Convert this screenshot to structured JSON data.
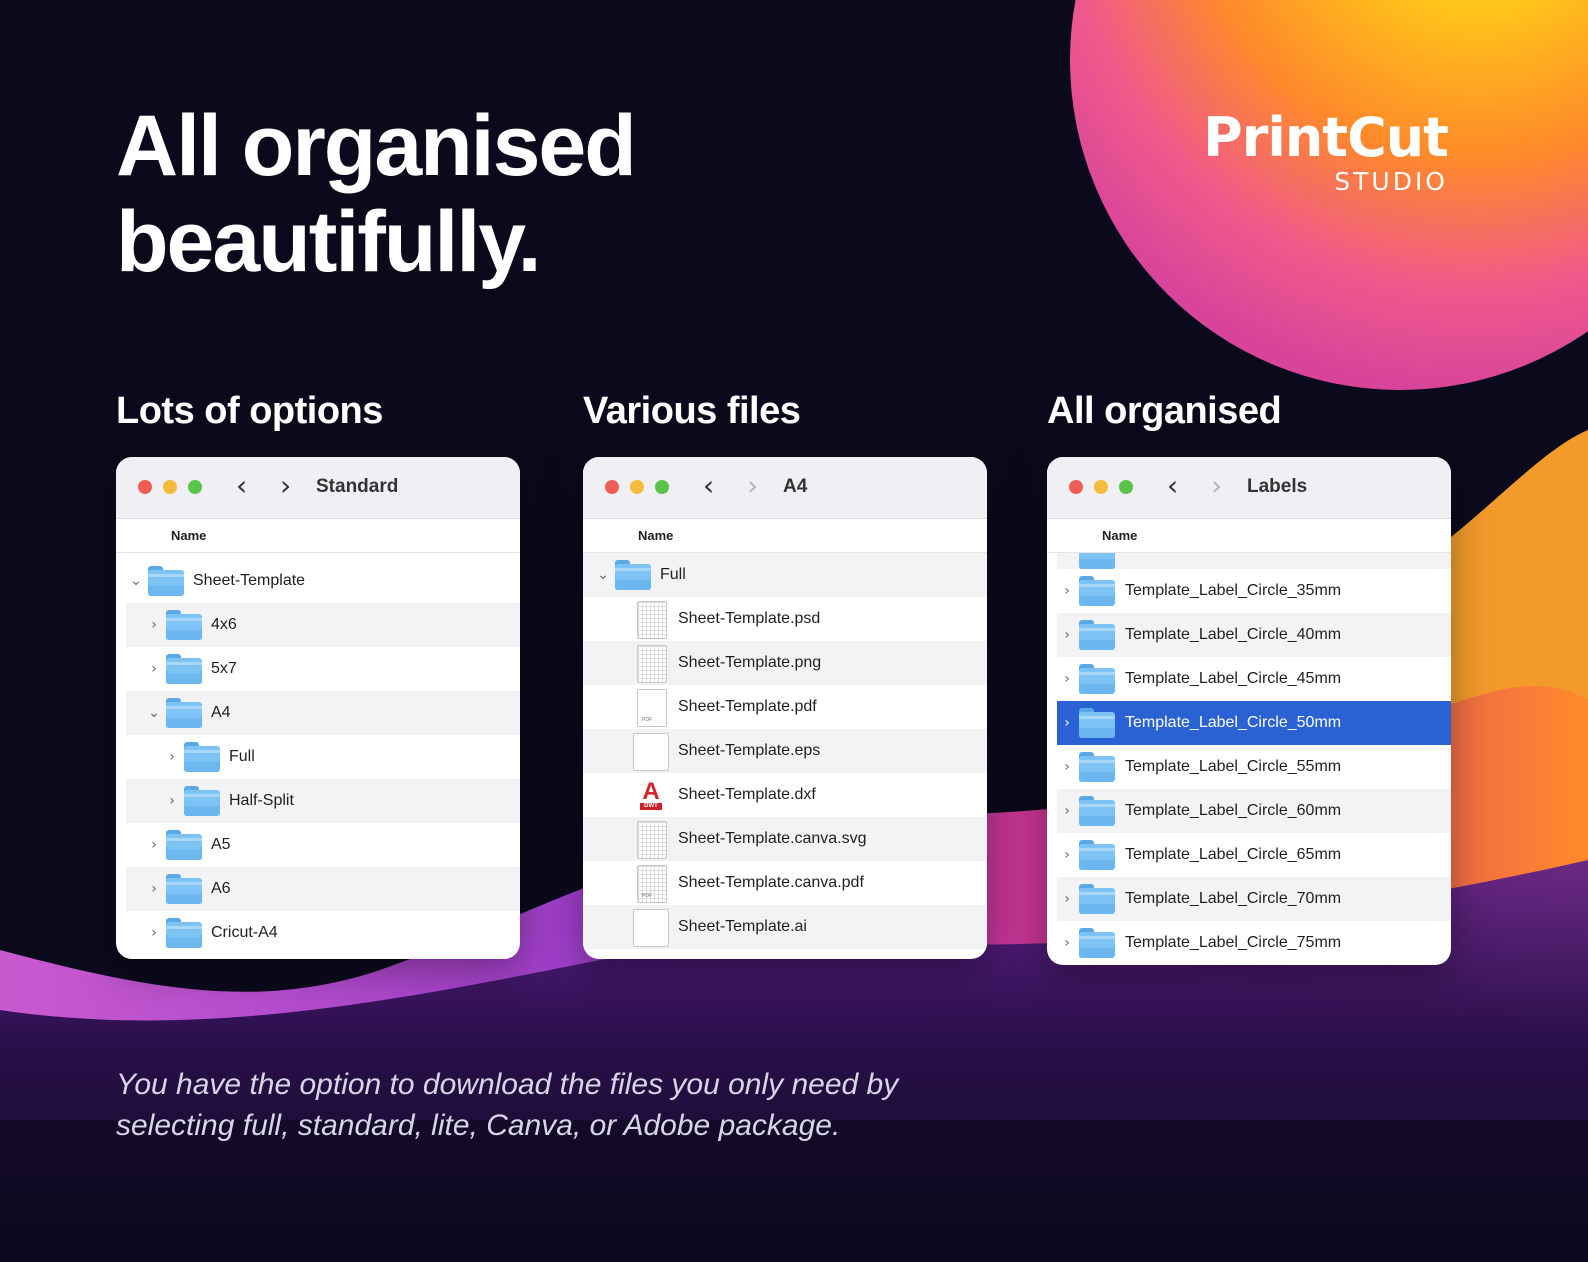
{
  "headline": {
    "line1": "All organised",
    "line2": "beautifully."
  },
  "brand": {
    "name": "PrintCut",
    "sub": "STUDIO"
  },
  "sections": {
    "left_title": "Lots of options",
    "middle_title": "Various files",
    "right_title": "All organised"
  },
  "windows": {
    "left": {
      "title": "Standard",
      "column": "Name",
      "rows": [
        {
          "label": "Sheet-Template",
          "chevron": "⌄",
          "level": 0
        },
        {
          "label": "4x6",
          "chevron": "›",
          "level": 1
        },
        {
          "label": "5x7",
          "chevron": "›",
          "level": 1
        },
        {
          "label": "A4",
          "chevron": "⌄",
          "level": 1
        },
        {
          "label": "Full",
          "chevron": "›",
          "level": 2
        },
        {
          "label": "Half-Split",
          "chevron": "›",
          "level": 2
        },
        {
          "label": "A5",
          "chevron": "›",
          "level": 1
        },
        {
          "label": "A6",
          "chevron": "›",
          "level": 1
        },
        {
          "label": "Cricut-A4",
          "chevron": "›",
          "level": 1
        }
      ]
    },
    "middle": {
      "title": "A4",
      "column": "Name",
      "rows": [
        {
          "label": "Full",
          "chevron": "⌄",
          "icon": "folder-icon"
        },
        {
          "label": "Sheet-Template.psd",
          "icon": "psd-file-icon"
        },
        {
          "label": "Sheet-Template.png",
          "icon": "png-file-icon"
        },
        {
          "label": "Sheet-Template.pdf",
          "icon": "pdf-file-icon"
        },
        {
          "label": "Sheet-Template.eps",
          "icon": "eps-file-icon"
        },
        {
          "label": "Sheet-Template.dxf",
          "icon": "dwt-file-icon"
        },
        {
          "label": "Sheet-Template.canva.svg",
          "icon": "svg-file-icon"
        },
        {
          "label": "Sheet-Template.canva.pdf",
          "icon": "pdf-file-icon"
        },
        {
          "label": "Sheet-Template.ai",
          "icon": "ai-file-icon"
        }
      ],
      "dwt_tag": "DWT",
      "pdf_tag": "PDF"
    },
    "right": {
      "title": "Labels",
      "column": "Name",
      "rows": [
        {
          "label": "Template_Label_Circle_35mm",
          "chevron": "›"
        },
        {
          "label": "Template_Label_Circle_40mm",
          "chevron": "›"
        },
        {
          "label": "Template_Label_Circle_45mm",
          "chevron": "›"
        },
        {
          "label": "Template_Label_Circle_50mm",
          "chevron": "›",
          "selected": true
        },
        {
          "label": "Template_Label_Circle_55mm",
          "chevron": "›"
        },
        {
          "label": "Template_Label_Circle_60mm",
          "chevron": "›"
        },
        {
          "label": "Template_Label_Circle_65mm",
          "chevron": "›"
        },
        {
          "label": "Template_Label_Circle_70mm",
          "chevron": "›"
        },
        {
          "label": "Template_Label_Circle_75mm",
          "chevron": "›"
        }
      ]
    }
  },
  "footer": {
    "line1": "You have the option to download the files you only need by",
    "line2": "selecting full, standard, lite, Canva, or Adobe package."
  },
  "colors": {
    "background": "#0a0a1c",
    "selection": "#2a62d3",
    "folder": "#7ec3f5",
    "light_red": "#ee5e57",
    "light_yellow": "#f3bc3f",
    "light_green": "#5ac34a"
  }
}
